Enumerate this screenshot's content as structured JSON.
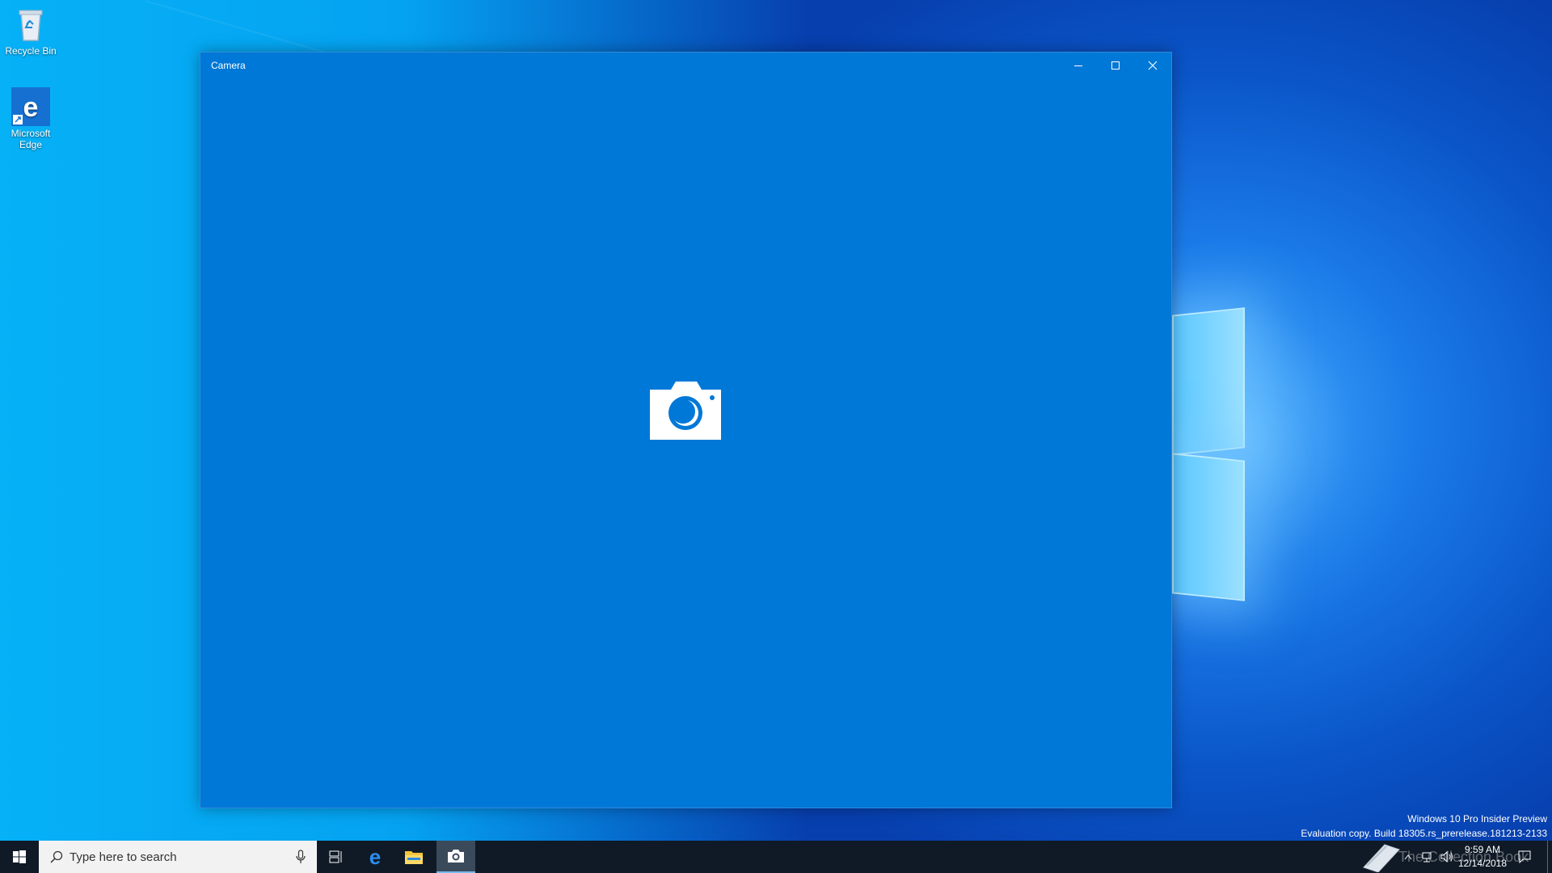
{
  "desktop": {
    "icons": [
      {
        "label": "Recycle Bin",
        "icon": "recycle-bin-icon"
      },
      {
        "label": "Microsoft Edge",
        "icon": "edge-icon"
      }
    ],
    "watermark_line1": "Windows 10 Pro Insider Preview",
    "watermark_line2": "Evaluation copy. Build 18305.rs_prerelease.181213-2133",
    "overlay_logo_text": "The Collection Book"
  },
  "window": {
    "title": "Camera",
    "controls": [
      "minimize-icon",
      "maximize-icon",
      "close-icon"
    ],
    "center_icon": "camera-icon",
    "background": "#0078d7"
  },
  "taskbar": {
    "search_placeholder": "Type here to search",
    "pinned": [
      "task-view-icon",
      "edge-icon",
      "file-explorer-icon",
      "camera-icon"
    ],
    "active_app": "Camera",
    "clock_time": "9:59 AM",
    "clock_date": "12/14/2018"
  },
  "colors": {
    "accent": "#0078d7",
    "taskbar": "#0f1a26"
  }
}
